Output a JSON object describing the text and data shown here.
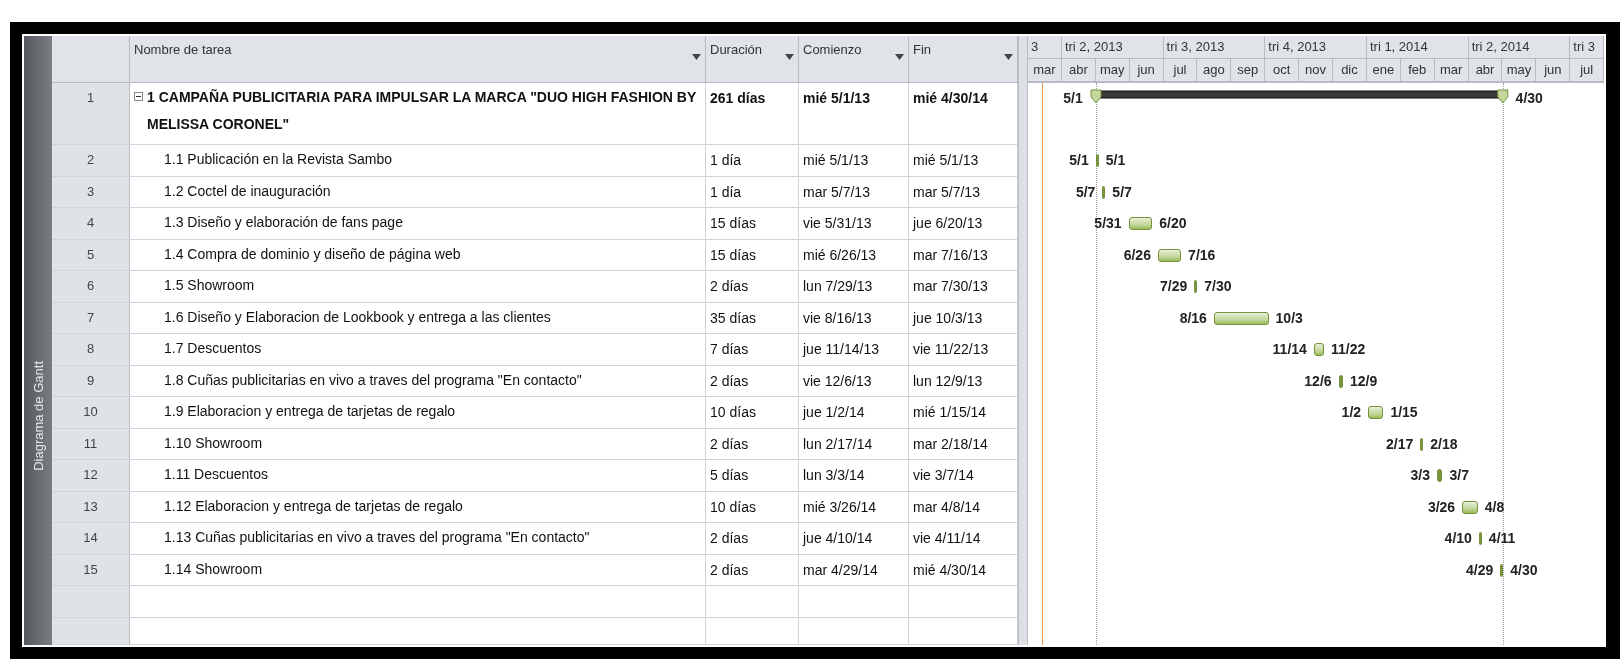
{
  "view_bar": {
    "label": "Diagrama de Gantt"
  },
  "columns": [
    {
      "label": "Nombre de tarea"
    },
    {
      "label": "Duración"
    },
    {
      "label": "Comienzo"
    },
    {
      "label": "Fin"
    }
  ],
  "timeline": {
    "quarters": [
      "3",
      "tri 2, 2013",
      "tri 3, 2013",
      "tri 4, 2013",
      "tri 1, 2014",
      "tri 2, 2014",
      "tri 3"
    ],
    "months": [
      "mar",
      "abr",
      "may",
      "jun",
      "jul",
      "ago",
      "sep",
      "oct",
      "nov",
      "dic",
      "ene",
      "feb",
      "mar",
      "abr",
      "may",
      "jun",
      "jul"
    ]
  },
  "tasks": [
    {
      "id": "1",
      "name": "1 CAMPAÑA PUBLICITARIA PARA IMPULSAR LA MARCA \"DUO HIGH FASHION BY MELISSA CORONEL\"",
      "duration": "261 días",
      "start": "mié 5/1/13",
      "finish": "mié 4/30/14",
      "kind": "summary",
      "expanded": true,
      "bar_start_label": "5/1",
      "bar_end_label": "4/30",
      "children": [
        {
          "id": "2",
          "name": "1.1 Publicación en la Revista Sambo",
          "duration": "1 día",
          "start": "mié 5/1/13",
          "finish": "mié 5/1/13",
          "kind": "task",
          "bar_start_label": "5/1",
          "bar_end_label": "5/1"
        },
        {
          "id": "3",
          "name": "1.2 Coctel de inauguración",
          "duration": "1 día",
          "start": "mar 5/7/13",
          "finish": "mar 5/7/13",
          "kind": "task",
          "bar_start_label": "5/7",
          "bar_end_label": "5/7"
        },
        {
          "id": "4",
          "name": "1.3 Diseño y elaboración de fans page",
          "duration": "15 días",
          "start": "vie 5/31/13",
          "finish": "jue 6/20/13",
          "kind": "task",
          "bar_start_label": "5/31",
          "bar_end_label": "6/20"
        },
        {
          "id": "5",
          "name": "1.4 Compra de dominio y diseño de página web",
          "duration": "15 días",
          "start": "mié 6/26/13",
          "finish": "mar 7/16/13",
          "kind": "task",
          "bar_start_label": "6/26",
          "bar_end_label": "7/16"
        },
        {
          "id": "6",
          "name": "1.5 Showroom",
          "duration": "2 días",
          "start": "lun 7/29/13",
          "finish": "mar 7/30/13",
          "kind": "task",
          "bar_start_label": "7/29",
          "bar_end_label": "7/30"
        },
        {
          "id": "7",
          "name": "1.6 Diseño y Elaboracion de Lookbook y entrega a las clientes",
          "duration": "35 días",
          "start": "vie 8/16/13",
          "finish": "jue 10/3/13",
          "kind": "task",
          "bar_start_label": "8/16",
          "bar_end_label": "10/3"
        },
        {
          "id": "8",
          "name": "1.7 Descuentos",
          "duration": "7 días",
          "start": "jue 11/14/13",
          "finish": "vie 11/22/13",
          "kind": "task",
          "bar_start_label": "11/14",
          "bar_end_label": "11/22"
        },
        {
          "id": "9",
          "name": "1.8 Cuñas publicitarias en vivo a traves del programa \"En contacto\"",
          "duration": "2 días",
          "start": "vie 12/6/13",
          "finish": "lun 12/9/13",
          "kind": "task",
          "bar_start_label": "12/6",
          "bar_end_label": "12/9"
        },
        {
          "id": "10",
          "name": "1.9 Elaboracion y entrega de tarjetas de regalo",
          "duration": "10 días",
          "start": "jue 1/2/14",
          "finish": "mié 1/15/14",
          "kind": "task",
          "bar_start_label": "1/2",
          "bar_end_label": "1/15"
        },
        {
          "id": "11",
          "name": "1.10 Showroom",
          "duration": "2 días",
          "start": "lun 2/17/14",
          "finish": "mar 2/18/14",
          "kind": "task",
          "bar_start_label": "2/17",
          "bar_end_label": "2/18"
        },
        {
          "id": "12",
          "name": "1.11 Descuentos",
          "duration": "5 días",
          "start": "lun 3/3/14",
          "finish": "vie 3/7/14",
          "kind": "task",
          "bar_start_label": "3/3",
          "bar_end_label": "3/7"
        },
        {
          "id": "13",
          "name": "1.12 Elaboracion y entrega de tarjetas de regalo",
          "duration": "10 días",
          "start": "mié 3/26/14",
          "finish": "mar 4/8/14",
          "kind": "task",
          "bar_start_label": "3/26",
          "bar_end_label": "4/8"
        },
        {
          "id": "14",
          "name": "1.13 Cuñas publicitarias en vivo a traves del programa \"En contacto\"",
          "duration": "2 días",
          "start": "jue 4/10/14",
          "finish": "vie 4/11/14",
          "kind": "task",
          "bar_start_label": "4/10",
          "bar_end_label": "4/11"
        },
        {
          "id": "15",
          "name": "1.14 Showroom",
          "duration": "2 días",
          "start": "mar 4/29/14",
          "finish": "mié 4/30/14",
          "kind": "task",
          "bar_start_label": "4/29",
          "bar_end_label": "4/30"
        }
      ]
    }
  ]
}
